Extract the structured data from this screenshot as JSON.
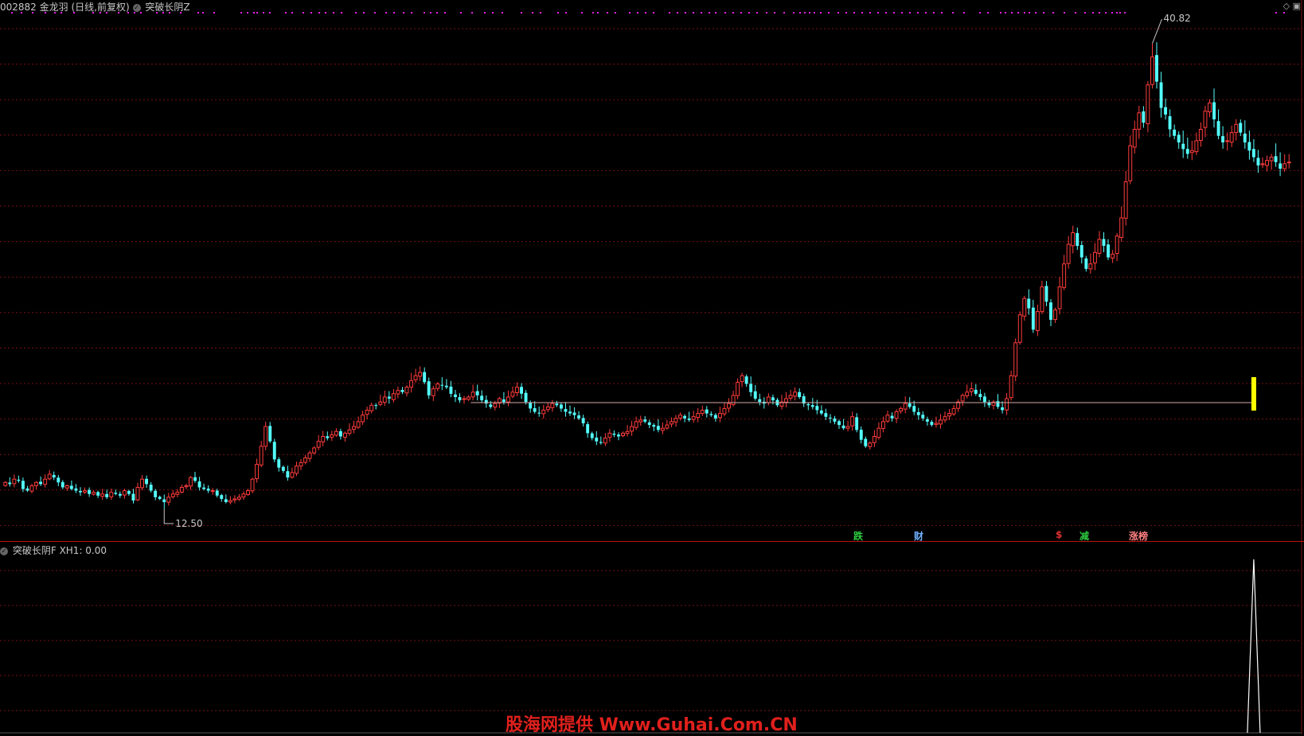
{
  "header": {
    "stock_code": "002882",
    "stock_name": "金龙羽",
    "period": "(日线,前复权)",
    "indicator_main": "突破长阴Z"
  },
  "sub_header": {
    "indicator": "突破长阴F",
    "value_label": "XH1: 0.00"
  },
  "price_labels": {
    "high": "40.82",
    "low": "12.50"
  },
  "markers": [
    {
      "text": "跌",
      "color": "#2ecc40"
    },
    {
      "text": "财",
      "color": "#6fb3ff"
    },
    {
      "text": "$",
      "color": "#e03030"
    },
    {
      "text": "减",
      "color": "#2ecc40"
    },
    {
      "text": "涨榜",
      "color": "#ff8080"
    }
  ],
  "watermark": "股海网提供 Www.Guhai.Com.CN",
  "colors": {
    "up": "#ff3b3b",
    "down": "#54ffff",
    "grid": "#7a1010",
    "signal": "#ffff00",
    "resistance": "#d8a8a8",
    "dots": "#e020e0",
    "spike": "#ffffff"
  },
  "chart_data": {
    "type": "candlestick",
    "y_range_main": [
      11.5,
      42.5
    ],
    "high": 40.82,
    "low": 12.5,
    "breakout_index": 283,
    "resistance_start": 106,
    "resistance_end": 283,
    "closes": [
      14.1,
      14.0,
      14.3,
      14.2,
      13.7,
      13.6,
      13.9,
      14.1,
      14.0,
      14.3,
      14.6,
      14.4,
      14.1,
      13.8,
      13.9,
      13.7,
      13.6,
      13.5,
      13.6,
      13.4,
      13.5,
      13.3,
      13.4,
      13.2,
      13.5,
      13.4,
      13.3,
      13.6,
      13.4,
      13.0,
      13.8,
      14.3,
      14.0,
      13.6,
      13.2,
      13.1,
      12.9,
      13.2,
      13.4,
      13.5,
      13.8,
      13.9,
      14.4,
      14.2,
      13.8,
      13.7,
      13.6,
      13.6,
      13.3,
      13.1,
      12.9,
      13.0,
      13.1,
      13.2,
      13.4,
      13.6,
      14.3,
      15.2,
      16.3,
      17.5,
      16.6,
      15.5,
      15.0,
      14.8,
      14.4,
      14.7,
      15.1,
      15.3,
      15.6,
      15.9,
      16.2,
      16.6,
      16.9,
      16.8,
      17.0,
      17.2,
      16.9,
      17.1,
      17.3,
      17.5,
      17.8,
      18.2,
      18.5,
      18.8,
      18.8,
      19.0,
      19.3,
      19.2,
      19.5,
      19.7,
      19.6,
      19.9,
      20.3,
      20.6,
      20.8,
      20.2,
      19.4,
      19.8,
      20.1,
      20.0,
      19.9,
      19.5,
      19.3,
      19.1,
      19.2,
      19.3,
      19.6,
      19.4,
      19.1,
      18.9,
      18.7,
      18.9,
      19.2,
      19.0,
      19.3,
      19.6,
      19.9,
      19.5,
      19.0,
      18.6,
      18.4,
      18.3,
      18.5,
      18.7,
      18.9,
      18.8,
      18.6,
      18.4,
      18.3,
      18.2,
      18.0,
      17.7,
      17.1,
      16.8,
      16.6,
      16.5,
      16.8,
      17.1,
      17.0,
      16.9,
      17.1,
      17.2,
      17.5,
      17.8,
      17.9,
      17.8,
      17.6,
      17.5,
      17.3,
      17.4,
      17.6,
      17.8,
      18.0,
      18.2,
      18.0,
      17.9,
      18.1,
      18.3,
      18.5,
      18.3,
      18.2,
      18.0,
      18.3,
      18.6,
      18.9,
      19.4,
      20.2,
      20.6,
      20.1,
      19.6,
      19.2,
      19.0,
      18.9,
      19.3,
      19.1,
      18.8,
      19.0,
      19.2,
      19.4,
      19.6,
      19.3,
      18.9,
      18.8,
      18.7,
      18.5,
      18.3,
      18.1,
      18.0,
      17.8,
      17.6,
      17.4,
      17.5,
      18.1,
      17.3,
      16.7,
      16.3,
      16.5,
      16.9,
      17.4,
      17.8,
      18.2,
      18.0,
      18.4,
      18.6,
      18.9,
      18.7,
      18.4,
      18.2,
      18.0,
      17.8,
      17.6,
      17.7,
      17.9,
      18.1,
      18.3,
      18.6,
      19.0,
      19.4,
      19.6,
      19.8,
      19.5,
      19.3,
      19.0,
      18.8,
      19.0,
      18.7,
      18.5,
      19.2,
      20.6,
      22.6,
      24.3,
      25.3,
      24.7,
      23.4,
      24.5,
      26.0,
      25.1,
      24.0,
      24.6,
      26.0,
      27.4,
      28.6,
      29.3,
      28.5,
      27.8,
      27.1,
      27.4,
      28.1,
      28.9,
      28.5,
      27.8,
      28.0,
      29.1,
      30.2,
      32.4,
      34.6,
      35.6,
      36.6,
      36.0,
      38.3,
      40.0,
      38.5,
      36.9,
      36.5,
      35.6,
      35.2,
      34.8,
      34.4,
      34.1,
      34.3,
      34.9,
      35.6,
      36.7,
      37.2,
      36.2,
      35.2,
      34.8,
      34.9,
      35.4,
      35.9,
      35.4,
      34.8,
      34.3,
      33.9,
      33.4,
      33.5,
      33.7,
      33.9,
      33.6,
      33.2,
      33.5,
      33.6
    ]
  }
}
